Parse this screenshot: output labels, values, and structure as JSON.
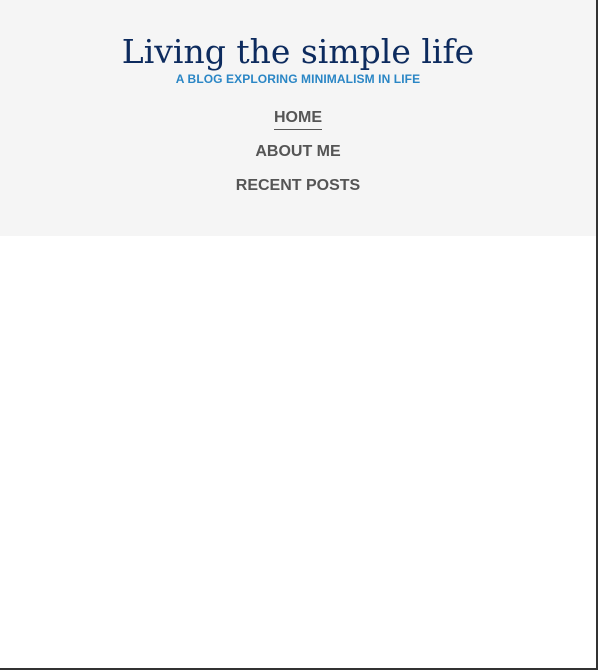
{
  "header": {
    "site_title": "Living the simple life",
    "tagline": "A BLOG EXPLORING MINIMALISM IN LIFE"
  },
  "nav": {
    "items": [
      {
        "label": "HOME",
        "active": true
      },
      {
        "label": "ABOUT ME",
        "active": false
      },
      {
        "label": "RECENT POSTS",
        "active": false
      }
    ]
  },
  "colors": {
    "header_bg": "#f5f5f5",
    "title": "#0d2b5e",
    "tagline": "#2a86c5",
    "nav_text": "#555555"
  }
}
